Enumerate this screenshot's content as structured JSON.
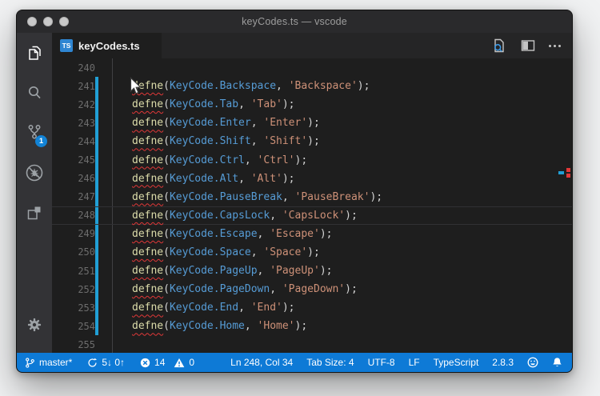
{
  "window": {
    "title": "keyCodes.ts — vscode"
  },
  "tab_bar": {
    "tab_label": "keyCodes.ts",
    "tab_icon_text": "TS"
  },
  "activity_bar": {
    "items": [
      "explorer",
      "search",
      "source-control",
      "debug",
      "extensions"
    ],
    "active_item": "explorer",
    "scm_badge": "1",
    "bottom_items": [
      "settings"
    ]
  },
  "editor": {
    "current_line": 248,
    "lines": [
      {
        "num": 240,
        "mod": false,
        "tokens": []
      },
      {
        "num": 241,
        "mod": true,
        "tokens": [
          [
            "fn-err",
            "defne"
          ],
          [
            "pn",
            "("
          ],
          [
            "id",
            "KeyCode.Backspace"
          ],
          [
            "pn",
            ", "
          ],
          [
            "st",
            "'Backspace'"
          ],
          [
            "pn",
            ");"
          ]
        ]
      },
      {
        "num": 242,
        "mod": true,
        "tokens": [
          [
            "fn-err",
            "defne"
          ],
          [
            "pn",
            "("
          ],
          [
            "id",
            "KeyCode.Tab"
          ],
          [
            "pn",
            ", "
          ],
          [
            "st",
            "'Tab'"
          ],
          [
            "pn",
            ");"
          ]
        ]
      },
      {
        "num": 243,
        "mod": true,
        "tokens": [
          [
            "fn-err",
            "defne"
          ],
          [
            "pn",
            "("
          ],
          [
            "id",
            "KeyCode.Enter"
          ],
          [
            "pn",
            ", "
          ],
          [
            "st",
            "'Enter'"
          ],
          [
            "pn",
            ");"
          ]
        ]
      },
      {
        "num": 244,
        "mod": true,
        "tokens": [
          [
            "fn-err",
            "defne"
          ],
          [
            "pn",
            "("
          ],
          [
            "id",
            "KeyCode.Shift"
          ],
          [
            "pn",
            ", "
          ],
          [
            "st",
            "'Shift'"
          ],
          [
            "pn",
            ");"
          ]
        ]
      },
      {
        "num": 245,
        "mod": true,
        "tokens": [
          [
            "fn-err",
            "defne"
          ],
          [
            "pn",
            "("
          ],
          [
            "id",
            "KeyCode.Ctrl"
          ],
          [
            "pn",
            ", "
          ],
          [
            "st",
            "'Ctrl'"
          ],
          [
            "pn",
            ");"
          ]
        ]
      },
      {
        "num": 246,
        "mod": true,
        "tokens": [
          [
            "fn-err",
            "defne"
          ],
          [
            "pn",
            "("
          ],
          [
            "id",
            "KeyCode.Alt"
          ],
          [
            "pn",
            ", "
          ],
          [
            "st",
            "'Alt'"
          ],
          [
            "pn",
            ");"
          ]
        ]
      },
      {
        "num": 247,
        "mod": true,
        "tokens": [
          [
            "fn-err",
            "defne"
          ],
          [
            "pn",
            "("
          ],
          [
            "id",
            "KeyCode.PauseBreak"
          ],
          [
            "pn",
            ", "
          ],
          [
            "st",
            "'PauseBreak'"
          ],
          [
            "pn",
            ");"
          ]
        ]
      },
      {
        "num": 248,
        "mod": true,
        "tokens": [
          [
            "fn-err",
            "defne"
          ],
          [
            "pn",
            "("
          ],
          [
            "id",
            "KeyCode.CapsLock"
          ],
          [
            "pn",
            ", "
          ],
          [
            "st",
            "'CapsLock'"
          ],
          [
            "pn",
            ");"
          ]
        ]
      },
      {
        "num": 249,
        "mod": true,
        "tokens": [
          [
            "fn-err",
            "defne"
          ],
          [
            "pn",
            "("
          ],
          [
            "id",
            "KeyCode.Escape"
          ],
          [
            "pn",
            ", "
          ],
          [
            "st",
            "'Escape'"
          ],
          [
            "pn",
            ");"
          ]
        ]
      },
      {
        "num": 250,
        "mod": true,
        "tokens": [
          [
            "fn-err",
            "defne"
          ],
          [
            "pn",
            "("
          ],
          [
            "id",
            "KeyCode.Space"
          ],
          [
            "pn",
            ", "
          ],
          [
            "st",
            "'Space'"
          ],
          [
            "pn",
            ");"
          ]
        ]
      },
      {
        "num": 251,
        "mod": true,
        "tokens": [
          [
            "fn-err",
            "defne"
          ],
          [
            "pn",
            "("
          ],
          [
            "id",
            "KeyCode.PageUp"
          ],
          [
            "pn",
            ", "
          ],
          [
            "st",
            "'PageUp'"
          ],
          [
            "pn",
            ");"
          ]
        ]
      },
      {
        "num": 252,
        "mod": true,
        "tokens": [
          [
            "fn-err",
            "defne"
          ],
          [
            "pn",
            "("
          ],
          [
            "id",
            "KeyCode.PageDown"
          ],
          [
            "pn",
            ", "
          ],
          [
            "st",
            "'PageDown'"
          ],
          [
            "pn",
            ");"
          ]
        ]
      },
      {
        "num": 253,
        "mod": true,
        "tokens": [
          [
            "fn-err",
            "defne"
          ],
          [
            "pn",
            "("
          ],
          [
            "id",
            "KeyCode.End"
          ],
          [
            "pn",
            ", "
          ],
          [
            "st",
            "'End'"
          ],
          [
            "pn",
            ");"
          ]
        ]
      },
      {
        "num": 254,
        "mod": true,
        "tokens": [
          [
            "fn-err",
            "defne"
          ],
          [
            "pn",
            "("
          ],
          [
            "id",
            "KeyCode.Home"
          ],
          [
            "pn",
            ", "
          ],
          [
            "st",
            "'Home'"
          ],
          [
            "pn",
            ");"
          ]
        ]
      },
      {
        "num": 255,
        "mod": false,
        "tokens": []
      }
    ]
  },
  "status_bar": {
    "branch": "master*",
    "sync": "5↓ 0↑",
    "errors": "14",
    "warnings": "0",
    "position": "Ln 248, Col 34",
    "tab_size": "Tab Size: 4",
    "encoding": "UTF-8",
    "eol": "LF",
    "language": "TypeScript",
    "version": "2.8.3"
  },
  "colors": {
    "status_bar": "#0e7ad6",
    "badge": "#1283d6",
    "modified_gutter": "#219fd5",
    "error_red": "#e13838",
    "function_yellow": "#dcdcaa",
    "identifier_blue": "#569cd6",
    "string_orange": "#ce9178"
  }
}
